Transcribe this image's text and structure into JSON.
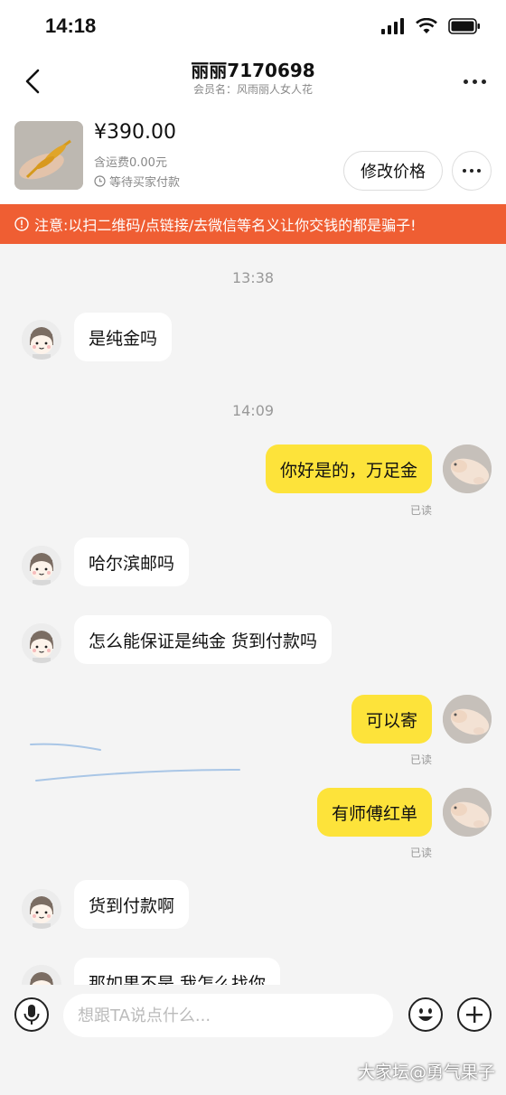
{
  "status_bar": {
    "time": "14:18"
  },
  "header": {
    "title": "丽丽7170698",
    "subtitle": "会员名：风雨丽人女人花"
  },
  "product": {
    "price": "¥390.00",
    "shipping": "含运费0.00元",
    "status": "等待买家付款",
    "edit_price_label": "修改价格"
  },
  "warning": {
    "text": "注意:以扫二维码/点链接/去微信等名义让你交钱的都是骗子!"
  },
  "messages": {
    "ts1": "13:38",
    "m1": "是纯金吗",
    "ts2": "14:09",
    "m2": "你好是的，万足金",
    "m2_read": "已读",
    "m3": "哈尔滨邮吗",
    "m4": "怎么能保证是纯金 货到付款吗",
    "m5": "可以寄",
    "m5_read": "已读",
    "m6": "有师傅红单",
    "m6_read": "已读",
    "m7": "货到付款啊",
    "m8": "那如果不是 我怎么找你"
  },
  "input": {
    "placeholder": "想跟TA说点什么..."
  },
  "watermark": "大家坛@勇气果子",
  "colors": {
    "accent_yellow": "#fde33a",
    "warning_orange": "#ef5e33"
  }
}
